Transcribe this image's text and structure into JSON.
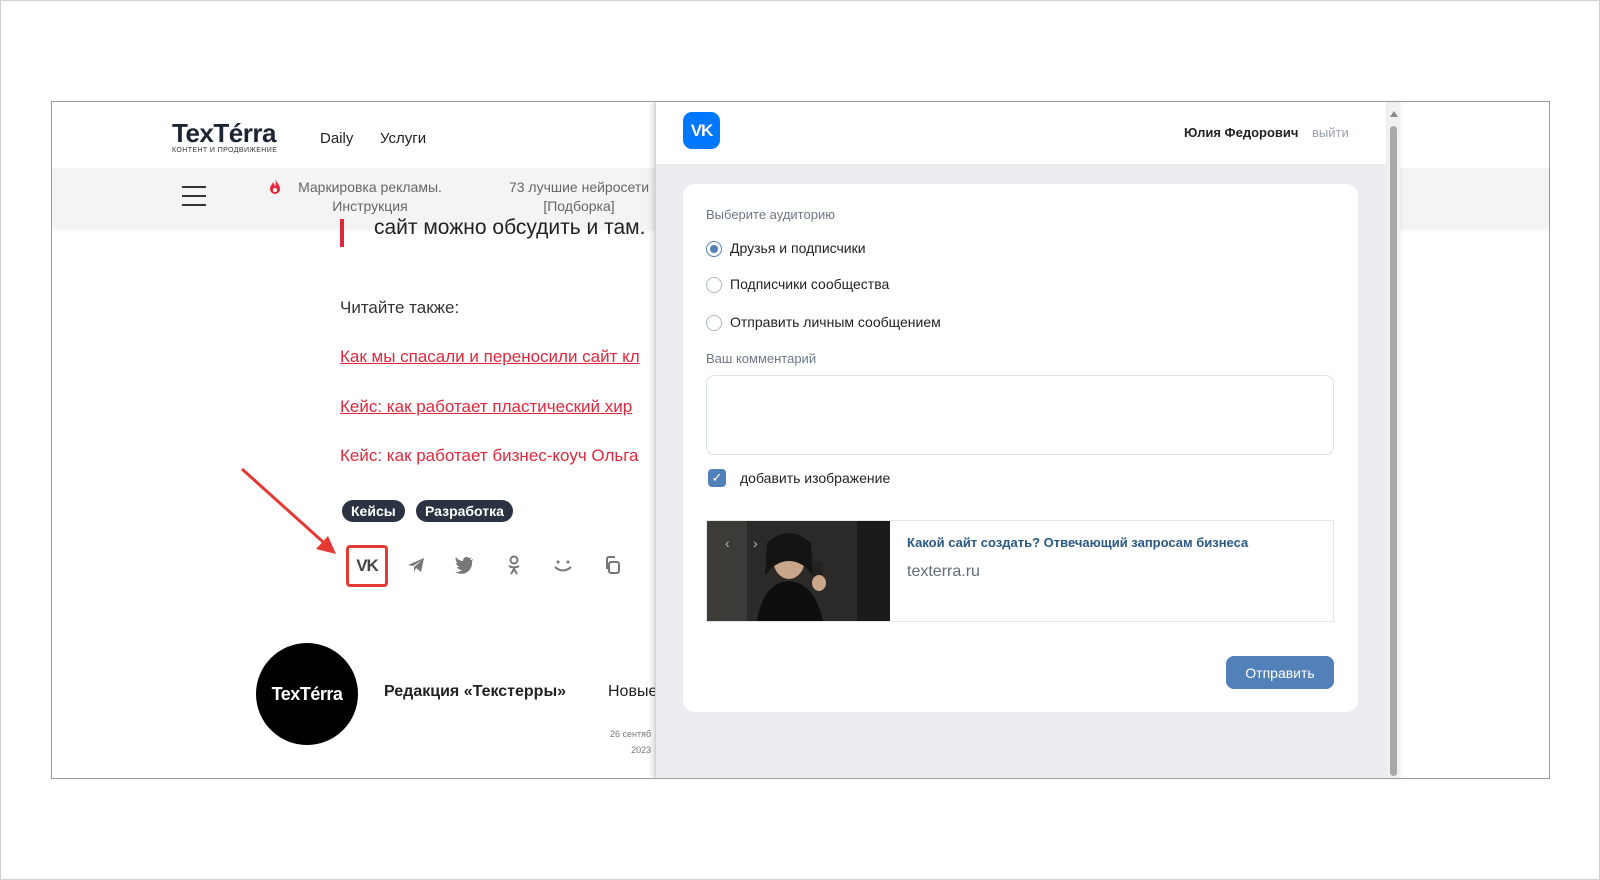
{
  "site": {
    "logo_text": "TexTérra",
    "logo_subtitle": "КОНТЕНТ И ПРОДВИЖЕНИЕ",
    "nav": [
      "Daily",
      "Услуги"
    ],
    "promo1_line1": "Маркировка рекламы.",
    "promo1_line2": "Инструкция",
    "promo2_line1": "73 лучшие нейросети",
    "promo2_line2": "[Подборка]",
    "quote_tail": "сайт можно обсудить и там.",
    "read_also": "Читайте также:",
    "related": [
      "Как мы спасали и переносили сайт кл",
      "Кейс: как работает пластический хир",
      "Кейс: как работает бизнес-коуч Ольга"
    ],
    "tags": [
      "Кейсы",
      "Разработка"
    ],
    "share_icons": [
      "vk-icon",
      "telegram-icon",
      "twitter-icon",
      "odnoklassniki-icon",
      "smile-icon",
      "copy-icon"
    ],
    "avatar_text": "TexTérra",
    "author": "Редакция «Текстерры»",
    "news": "Новые",
    "date_line1": "26 сентяб",
    "date_line2": "2023",
    "highlight_color": "#e53935"
  },
  "vk": {
    "logo": "VK",
    "user_name": "Юлия Федорович",
    "logout": "выйти",
    "audience_title": "Выберите аудиторию",
    "audience_options": [
      "Друзья и подписчики",
      "Подписчики сообщества",
      "Отправить личным сообщением"
    ],
    "selected_option": "Друзья и подписчики",
    "comment_title": "Ваш комментарий",
    "comment_value": "",
    "add_image_label": "добавить изображение",
    "add_image_checked": true,
    "preview_title": "Какой сайт создать? Отвечающий запросам бизнеса",
    "preview_domain": "texterra.ru",
    "send_label": "Отправить",
    "accent_color": "#5181b8"
  }
}
